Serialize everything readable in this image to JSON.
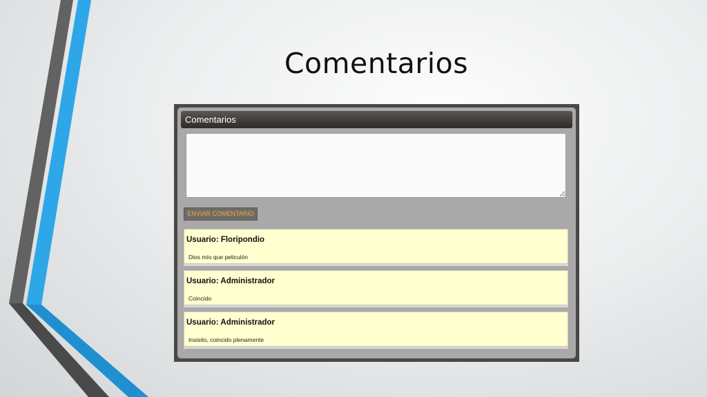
{
  "slide": {
    "title": "Comentarios"
  },
  "app": {
    "panel_title": "Comentarios",
    "textarea": {
      "value": "",
      "placeholder": ""
    },
    "send_button_label": "ENVIAR COMENTARIO",
    "comments": [
      {
        "user": "Usuario: Floripondio",
        "text": "Dios mío que peliculón"
      },
      {
        "user": "Usuario: Administrador",
        "text": "Coincido"
      },
      {
        "user": "Usuario: Administrador",
        "text": "Insisito, coincido plenamente"
      }
    ]
  },
  "colors": {
    "accent_blue": "#2ea7e8",
    "stripe_gray": "#5f5f5f",
    "header_dark": "#3a3734",
    "button_text": "#f0a830",
    "comment_bg": "#ffffd0"
  }
}
